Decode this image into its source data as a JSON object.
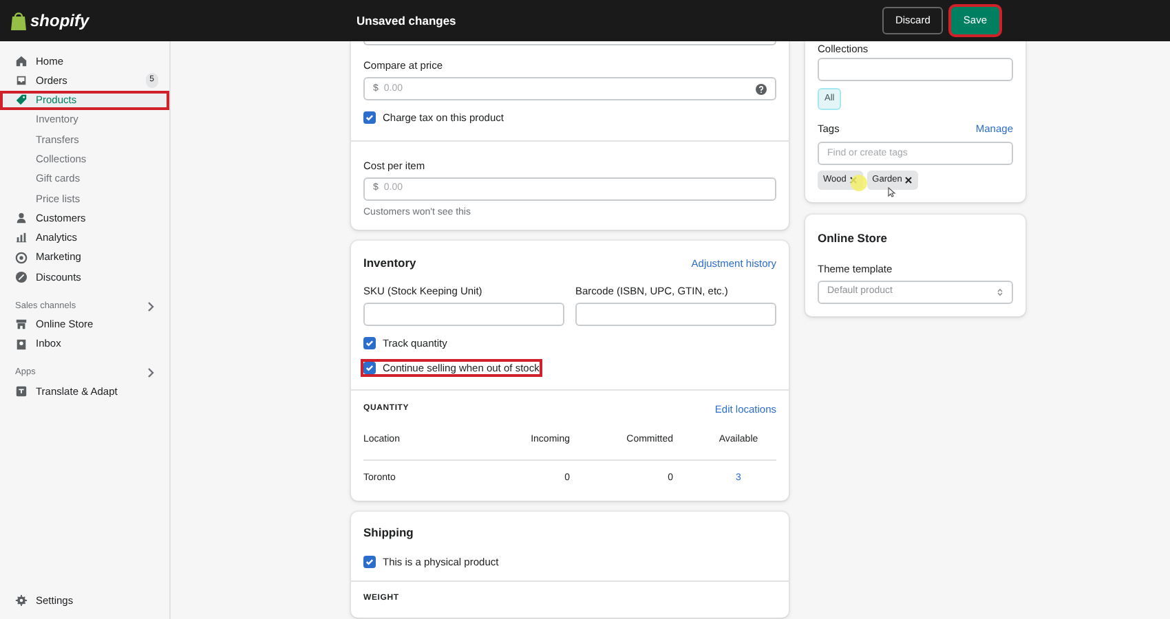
{
  "topbar": {
    "logo_text": "shopify",
    "title": "Unsaved changes",
    "buttons": [
      {
        "label": "Discard",
        "kind": "secondary",
        "highlighted": false
      },
      {
        "label": "Save",
        "kind": "primary",
        "highlighted": true
      }
    ]
  },
  "sidebar": {
    "groups": [
      {
        "items": [
          {
            "label": "Home",
            "selected": false,
            "highlighted": false
          },
          {
            "label": "Orders",
            "selected": false,
            "highlighted": false,
            "badge": "5"
          },
          {
            "label": "Products",
            "selected": true,
            "highlighted": true,
            "children": [
              {
                "label": "Inventory",
                "selected": false
              },
              {
                "label": "Transfers",
                "selected": false
              },
              {
                "label": "Collections",
                "selected": false
              },
              {
                "label": "Gift cards",
                "selected": false
              },
              {
                "label": "Price lists",
                "selected": false
              }
            ]
          },
          {
            "label": "Customers",
            "selected": false,
            "highlighted": false
          },
          {
            "label": "Analytics",
            "selected": false,
            "highlighted": false
          },
          {
            "label": "Marketing",
            "selected": false,
            "highlighted": false
          },
          {
            "label": "Discounts",
            "selected": false,
            "highlighted": false
          }
        ]
      },
      {
        "heading": "Sales channels",
        "items": [
          {
            "label": "Online Store",
            "selected": false,
            "highlighted": false
          },
          {
            "label": "Inbox",
            "selected": false,
            "highlighted": false
          }
        ]
      },
      {
        "heading": "Apps",
        "items": [
          {
            "label": "Translate & Adapt",
            "selected": false,
            "highlighted": false
          }
        ]
      }
    ],
    "footer_item": {
      "label": "Settings"
    }
  },
  "pricing_card": {
    "compare_at_price": {
      "label": "Compare at price",
      "prefix": "$",
      "placeholder": "0.00"
    },
    "checkbox": {
      "label": "Charge tax on this product",
      "checked": true
    },
    "cost_per_item": {
      "label": "Cost per item",
      "prefix": "$",
      "placeholder": "0.00",
      "help": "Customers won't see this"
    }
  },
  "inventory_card": {
    "title": "Inventory",
    "link": "Adjustment history",
    "fields": [
      {
        "label": "SKU (Stock Keeping Unit)"
      },
      {
        "label": "Barcode (ISBN, UPC, GTIN, etc.)"
      }
    ],
    "checkboxes": [
      {
        "label": "Track quantity",
        "checked": true,
        "highlighted": false
      },
      {
        "label": "Continue selling when out of stock",
        "checked": true,
        "highlighted": true
      }
    ],
    "quantity": {
      "heading": "QUANTITY",
      "link": "Edit locations",
      "columns": [
        "Location",
        "Incoming",
        "Committed",
        "Available"
      ],
      "rows": [
        [
          "Toronto",
          "0",
          "0",
          "3"
        ]
      ]
    }
  },
  "shipping_card": {
    "title": "Shipping",
    "checkbox": {
      "label": "This is a physical product",
      "checked": true
    },
    "subheading": "WEIGHT"
  },
  "organization_card": {
    "collections": {
      "label": "Collections",
      "chip": "All"
    },
    "tags": {
      "label": "Tags",
      "link": "Manage",
      "placeholder": "Find or create tags",
      "items": [
        "Wood",
        "Garden"
      ]
    }
  },
  "online_store_card": {
    "title": "Online Store",
    "select": {
      "label": "Theme template",
      "value": "Default product"
    }
  }
}
